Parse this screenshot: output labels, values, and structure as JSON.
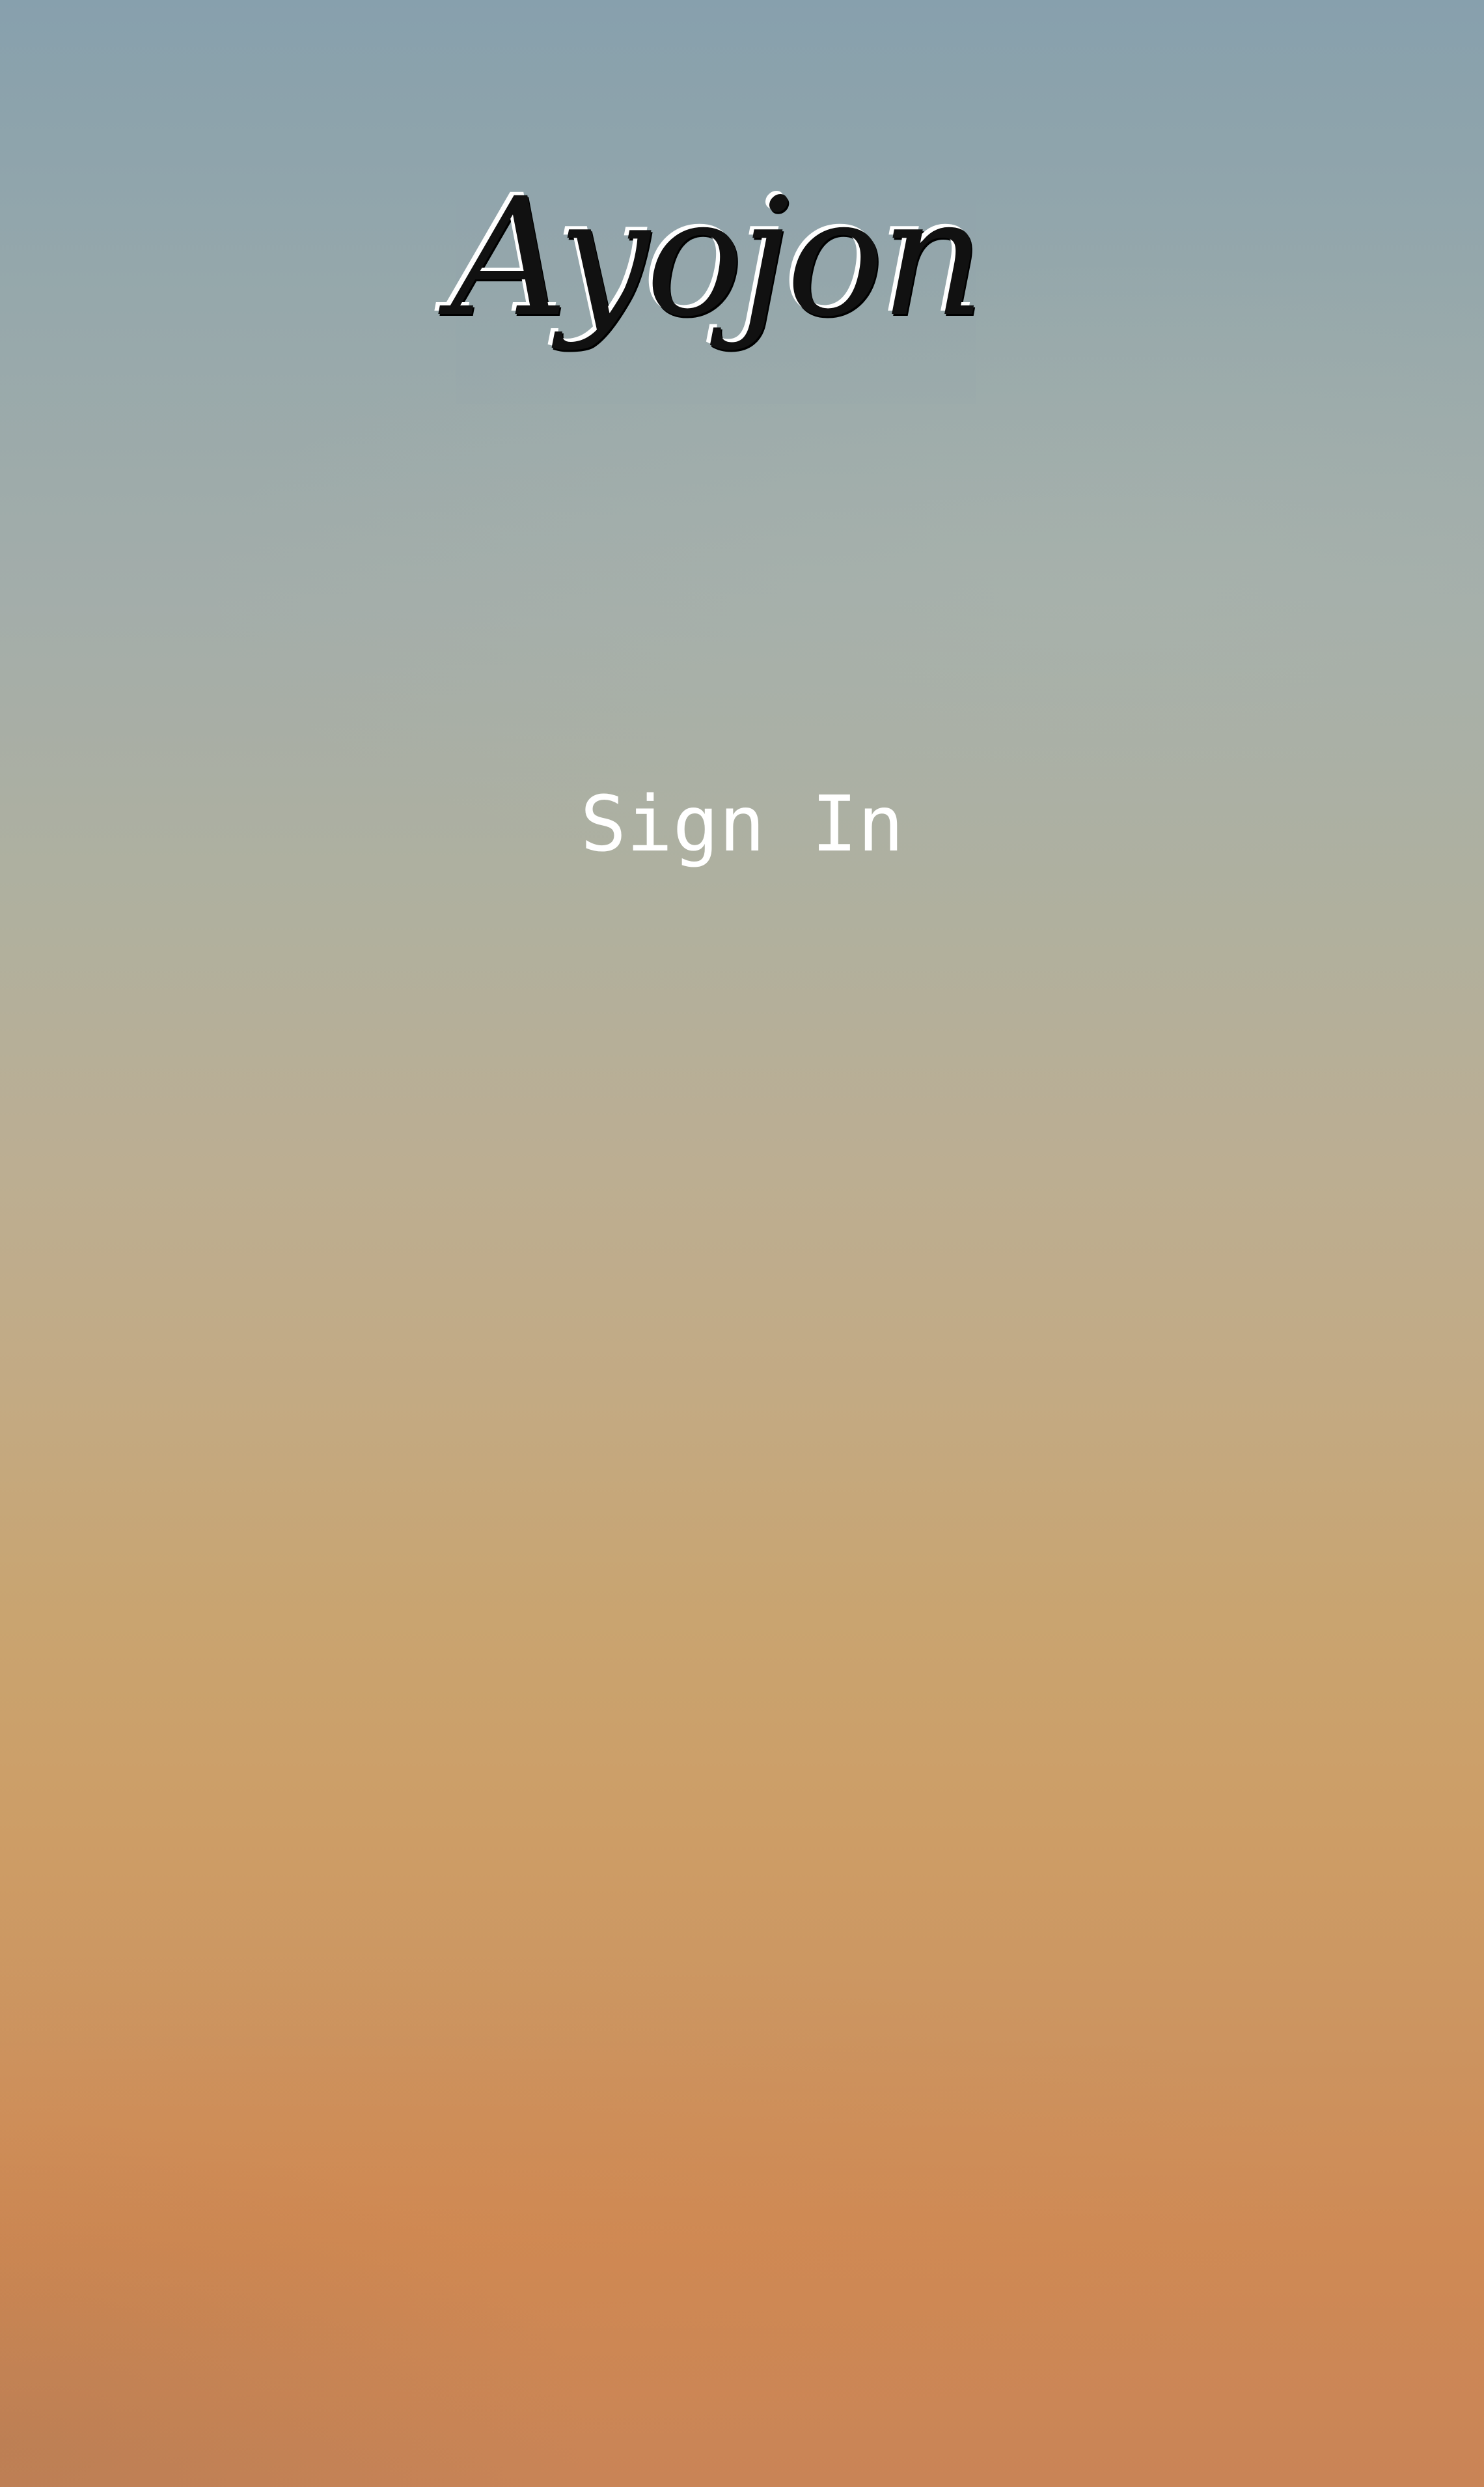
{
  "app": {
    "logo_text": "Ayojon"
  },
  "auth": {
    "sign_in_label": "Sign In"
  },
  "colors": {
    "sky_top": "#87a0ad",
    "sky_bottom": "#cf8a55",
    "sign_in_text": "#ffffff",
    "logo_text": "#111111"
  }
}
